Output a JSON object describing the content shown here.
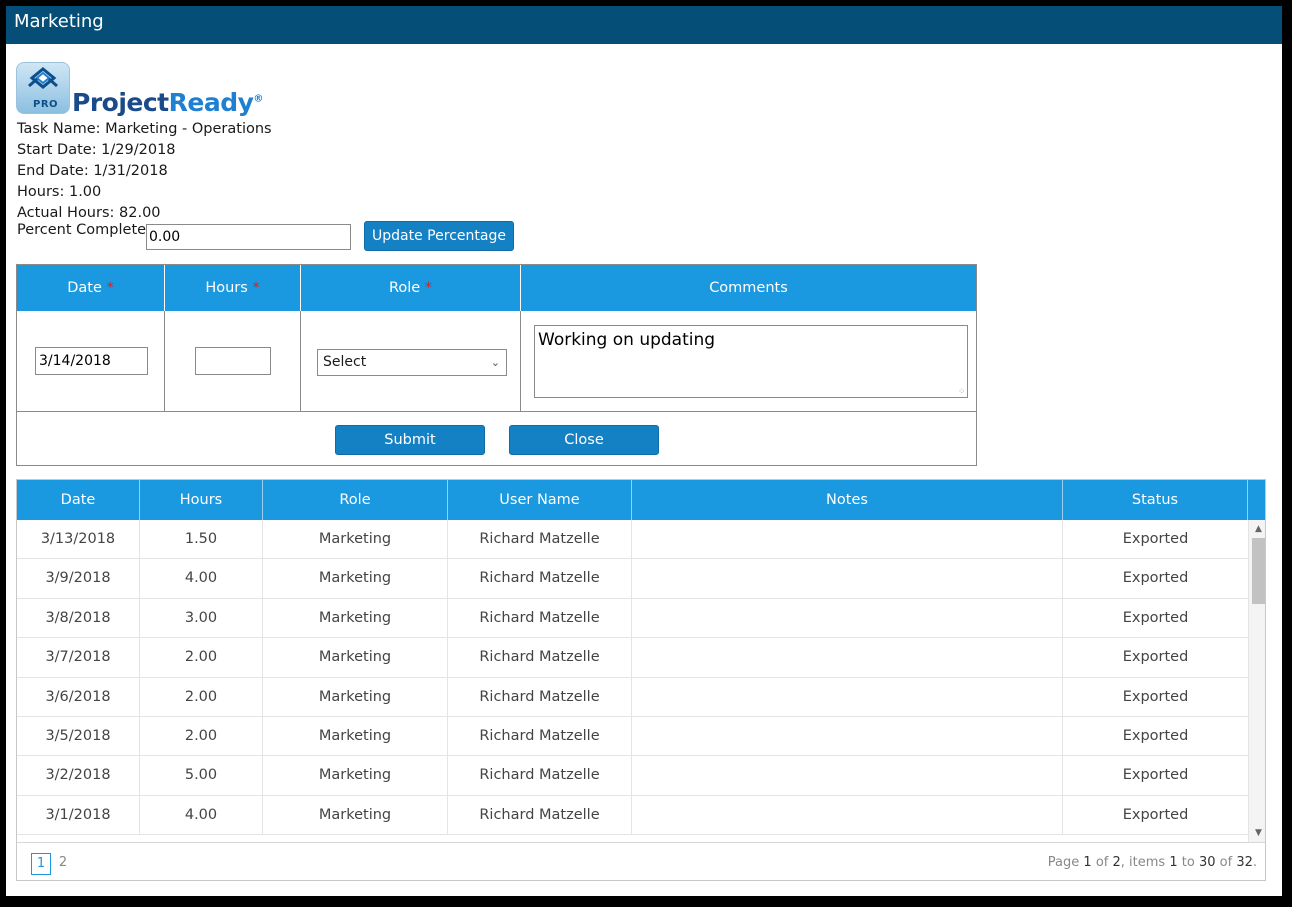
{
  "window": {
    "title": "Marketing"
  },
  "brand": {
    "name_part1": "Project",
    "name_part2": "Ready",
    "trademark": "®",
    "badge": "PRO"
  },
  "task": {
    "name_line": "Task Name: Marketing - Operations",
    "start_line": "Start Date: 1/29/2018",
    "end_line": "End Date: 1/31/2018",
    "hours_line": "Hours: 1.00",
    "actual_line": "Actual Hours: 82.00",
    "percent_label": "Percent Complete:",
    "percent_value": "0.00",
    "update_button": "Update Percentage"
  },
  "entry_form": {
    "headers": {
      "date": "Date",
      "hours": "Hours",
      "role": "Role",
      "comments": "Comments",
      "required_mark": "*"
    },
    "date_value": "3/14/2018",
    "hours_value": "",
    "role_selected": "Select",
    "comments_value": "Working on updating",
    "submit_button": "Submit",
    "close_button": "Close"
  },
  "grid": {
    "columns": [
      "Date",
      "Hours",
      "Role",
      "User Name",
      "Notes",
      "Status"
    ],
    "rows": [
      [
        "3/13/2018",
        "1.50",
        "Marketing",
        "Richard Matzelle",
        "",
        "Exported"
      ],
      [
        "3/9/2018",
        "4.00",
        "Marketing",
        "Richard Matzelle",
        "",
        "Exported"
      ],
      [
        "3/8/2018",
        "3.00",
        "Marketing",
        "Richard Matzelle",
        "",
        "Exported"
      ],
      [
        "3/7/2018",
        "2.00",
        "Marketing",
        "Richard Matzelle",
        "",
        "Exported"
      ],
      [
        "3/6/2018",
        "2.00",
        "Marketing",
        "Richard Matzelle",
        "",
        "Exported"
      ],
      [
        "3/5/2018",
        "2.00",
        "Marketing",
        "Richard Matzelle",
        "",
        "Exported"
      ],
      [
        "3/2/2018",
        "5.00",
        "Marketing",
        "Richard Matzelle",
        "",
        "Exported"
      ],
      [
        "3/1/2018",
        "4.00",
        "Marketing",
        "Richard Matzelle",
        "",
        "Exported"
      ]
    ]
  },
  "pager": {
    "pages": [
      "1",
      "2"
    ],
    "current_page": "1",
    "info_page_word": "Page",
    "info_current": "1",
    "info_of": "of",
    "info_total_pages": "2",
    "info_items_word": ", items",
    "info_from": "1",
    "info_to_word": "to",
    "info_to": "30",
    "info_of2": "of",
    "info_total_items": "32",
    "info_end": "."
  },
  "icons": {
    "scroll_up": "chevron-up-icon",
    "scroll_down": "chevron-down-icon",
    "select_arrow": "chevron-down-icon"
  },
  "colors": {
    "titlebar": "#044e78",
    "header_blue": "#1a98e0",
    "button_blue": "#1581c5",
    "required": "#e2201b"
  }
}
